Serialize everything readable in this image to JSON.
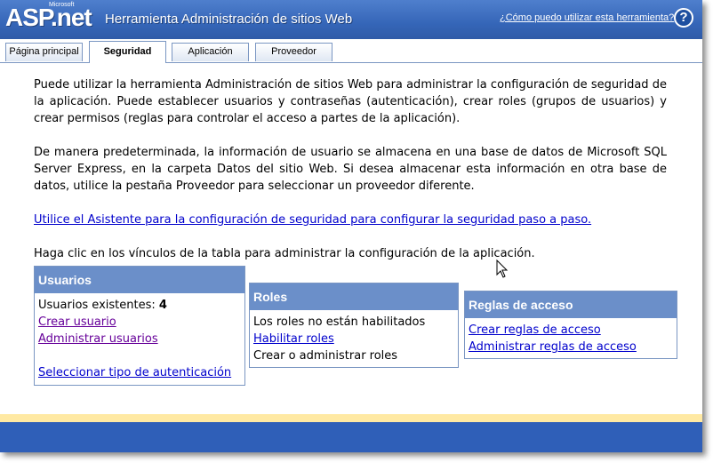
{
  "header": {
    "logo_main": "ASP.net",
    "logo_sup": "Microsoft",
    "title": "Herramienta Administración de sitios Web",
    "help_link": "¿Cómo puedo utilizar esta herramienta?",
    "help_icon": "?"
  },
  "tabs": [
    {
      "label": "Página principal",
      "active": false
    },
    {
      "label": "Seguridad",
      "active": true
    },
    {
      "label": "Aplicación",
      "active": false
    },
    {
      "label": "Proveedor",
      "active": false
    }
  ],
  "content": {
    "intro": "Puede utilizar la herramienta Administración de sitios Web para administrar la configuración de seguridad de la aplicación. Puede establecer usuarios y contraseñas (autenticación), crear roles (grupos de usuarios) y crear permisos (reglas para controlar el acceso a partes de la aplicación).",
    "storage": "De manera predeterminada, la información de usuario se almacena en una base de datos de Microsoft SQL Server Express, en la carpeta Datos del sitio Web. Si desea almacenar esta información en otra base de datos, utilice la pestaña Proveedor para seleccionar un proveedor diferente.",
    "wizard_link": "Utilice el Asistente para la configuración de seguridad para configurar la seguridad paso a paso.",
    "table_hint": "Haga clic en los vínculos de la tabla para administrar la configuración de la aplicación."
  },
  "panels": {
    "users": {
      "title": "Usuarios",
      "existing_label": "Usuarios existentes:",
      "existing_count": "4",
      "create": "Crear usuario",
      "manage": "Administrar usuarios",
      "auth_type": "Seleccionar tipo de autenticación"
    },
    "roles": {
      "title": "Roles",
      "status": "Los roles no están habilitados",
      "enable": "Habilitar roles",
      "manage_text": "Crear o administrar roles"
    },
    "access": {
      "title": "Reglas de acceso",
      "create": "Crear reglas de acceso",
      "manage": "Administrar reglas de acceso"
    }
  },
  "colors": {
    "header_blue": "#3566b8",
    "panel_header": "#6b8fc9",
    "link": "#0000cc",
    "visited_link": "#660099",
    "footer_stripe": "#ffe9a3",
    "footer_bar": "#2f5fb8"
  }
}
